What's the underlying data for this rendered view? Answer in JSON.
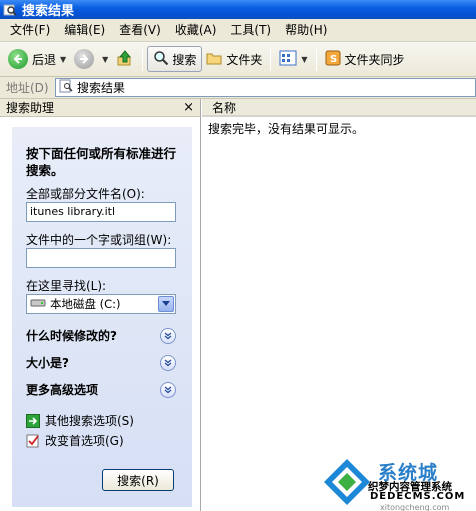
{
  "window": {
    "title": "搜索结果"
  },
  "menu": [
    "文件(F)",
    "编辑(E)",
    "查看(V)",
    "收藏(A)",
    "工具(T)",
    "帮助(H)"
  ],
  "toolbar": {
    "back_label": "后退",
    "search_label": "搜索",
    "folders_label": "文件夹",
    "sync_label": "文件夹同步"
  },
  "address": {
    "label": "地址(D)",
    "value": "搜索结果"
  },
  "left_pane": {
    "header": "搜索助理",
    "close_glyph": "×",
    "prompt": "按下面任何或所有标准进行搜索。",
    "filename_label": "全部或部分文件名(O):",
    "filename_value": "itunes library.itl",
    "phrase_label": "文件中的一个字或词组(W):",
    "phrase_value": "",
    "lookin_label": "在这里寻找(L):",
    "lookin_value": "本地磁盘 (C:)",
    "sections": [
      "什么时候修改的?",
      "大小是?",
      "更多高级选项"
    ],
    "links": [
      "其他搜索选项(S)",
      "改变首选项(G)"
    ],
    "search_button": "搜索(R)"
  },
  "right_pane": {
    "column_header": "名称",
    "message": "搜索完毕，没有结果可显示。"
  },
  "watermark": {
    "line1": "系统城",
    "line2": "织梦内容管理系统",
    "line3": "DEDECMS.COM",
    "line4": "xitongcheng.com"
  },
  "colors": {
    "title_bar": "#0a5fe0",
    "pane_bg": "#d6dff5",
    "accent": "#2a7fc8"
  }
}
